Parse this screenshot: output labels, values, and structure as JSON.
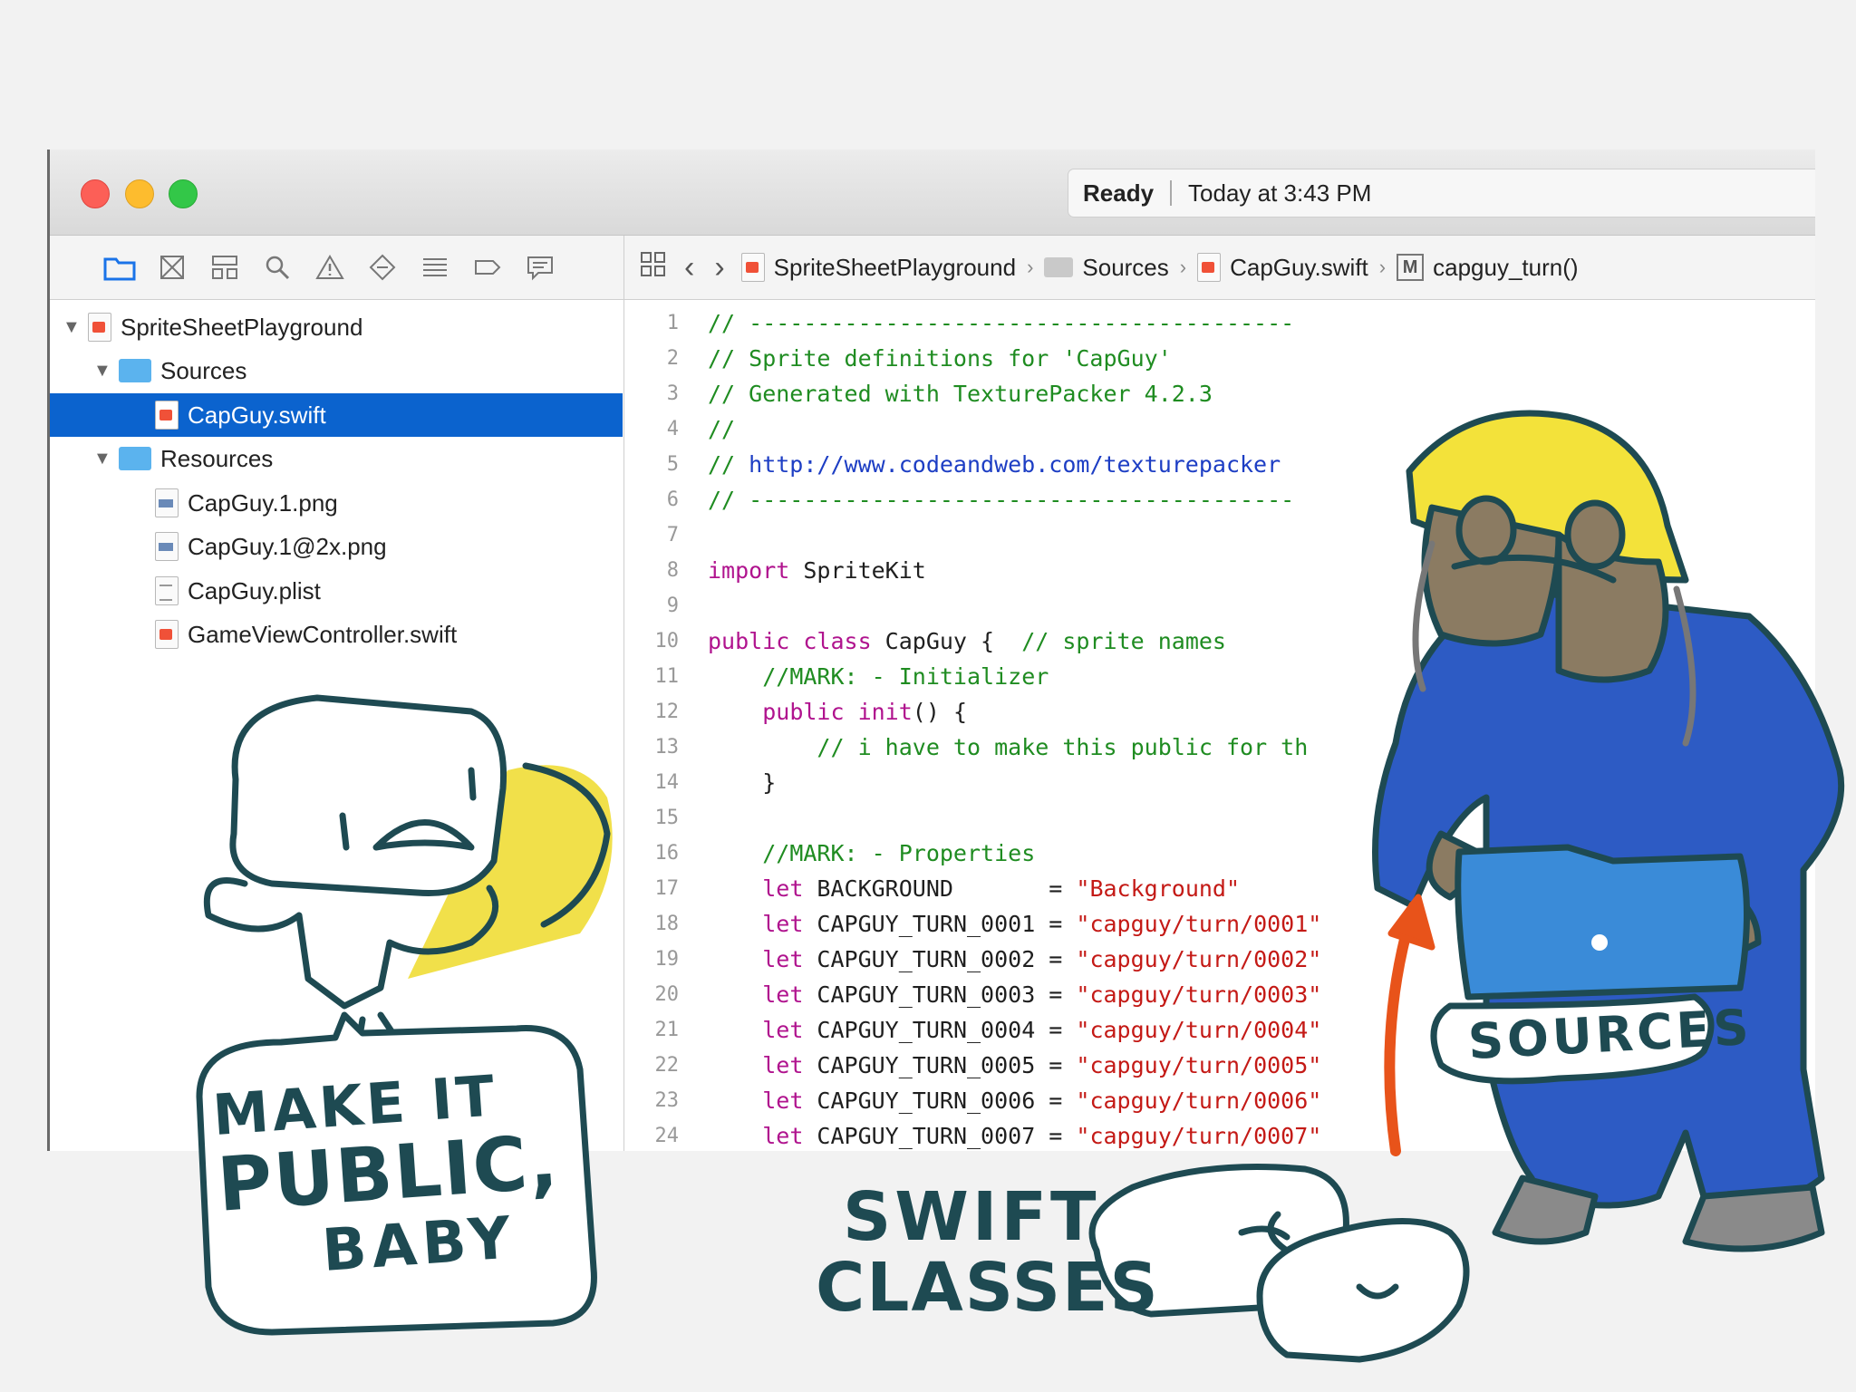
{
  "window": {
    "status": {
      "state": "Ready",
      "time": "Today at 3:43 PM"
    }
  },
  "jumpbar": {
    "items": [
      "SpriteSheetPlayground",
      "Sources",
      "CapGuy.swift",
      "capguy_turn()"
    ]
  },
  "navigator": {
    "project": "SpriteSheetPlayground",
    "groups": [
      {
        "name": "Sources",
        "files": [
          "CapGuy.swift"
        ]
      },
      {
        "name": "Resources",
        "files": [
          "CapGuy.1.png",
          "CapGuy.1@2x.png",
          "CapGuy.plist",
          "GameViewController.swift"
        ]
      }
    ],
    "selected": "CapGuy.swift"
  },
  "editor": {
    "lines": [
      {
        "n": "1",
        "cm": "// ----------------------------------------"
      },
      {
        "n": "2",
        "cm": "// Sprite definitions for 'CapGuy'"
      },
      {
        "n": "3",
        "cm": "// Generated with TexturePacker 4.2.3"
      },
      {
        "n": "4",
        "cm": "//"
      },
      {
        "n": "5",
        "cm": "// ",
        "url": "http://www.codeandweb.com/texturepacker"
      },
      {
        "n": "6",
        "cm": "// ----------------------------------------"
      },
      {
        "n": "7"
      },
      {
        "n": "8",
        "kw": "import",
        "pl": " SpriteKit"
      },
      {
        "n": "9"
      },
      {
        "n": "10",
        "kw": "public class",
        "pl": " CapGuy {  ",
        "cm2": "// sprite names"
      },
      {
        "n": "11",
        "indent": "    ",
        "cm": "//MARK: - Initializer"
      },
      {
        "n": "12",
        "indent": "    ",
        "kw": "public init",
        "pl": "() {"
      },
      {
        "n": "13",
        "indent": "        ",
        "cm": "// i have to make this public for th"
      },
      {
        "n": "14",
        "indent": "    ",
        "pl": "}"
      },
      {
        "n": "15"
      },
      {
        "n": "16",
        "indent": "    ",
        "cm": "//MARK: - Properties"
      },
      {
        "n": "17",
        "indent": "    ",
        "kw": "let",
        "pl": " BACKGROUND       = ",
        "st": "\"Background\""
      },
      {
        "n": "18",
        "indent": "    ",
        "kw": "let",
        "pl": " CAPGUY_TURN_0001 = ",
        "st": "\"capguy/turn/0001\""
      },
      {
        "n": "19",
        "indent": "    ",
        "kw": "let",
        "pl": " CAPGUY_TURN_0002 = ",
        "st": "\"capguy/turn/0002\""
      },
      {
        "n": "20",
        "indent": "    ",
        "kw": "let",
        "pl": " CAPGUY_TURN_0003 = ",
        "st": "\"capguy/turn/0003\""
      },
      {
        "n": "21",
        "indent": "    ",
        "kw": "let",
        "pl": " CAPGUY_TURN_0004 = ",
        "st": "\"capguy/turn/0004\""
      },
      {
        "n": "22",
        "indent": "    ",
        "kw": "let",
        "pl": " CAPGUY_TURN_0005 = ",
        "st": "\"capguy/turn/0005\""
      },
      {
        "n": "23",
        "indent": "    ",
        "kw": "let",
        "pl": " CAPGUY_TURN_0006 = ",
        "st": "\"capguy/turn/0006\""
      },
      {
        "n": "24",
        "indent": "    ",
        "kw": "let",
        "pl": " CAPGUY_TURN_0007 = ",
        "st": "\"capguy/turn/0007\""
      }
    ]
  },
  "doodles": {
    "left_bubble": [
      "MAKE IT",
      "PUBLIC,",
      "BABY"
    ],
    "bottom_caption": [
      "SWIFT",
      "CLASSES"
    ],
    "right_label": "SOURCES"
  },
  "colors": {
    "selection": "#0b63ce",
    "comment": "#1f8c21",
    "keyword": "#b0138e",
    "string": "#c41a16",
    "ink": "#1e4a52",
    "helmet": "#f3e23a",
    "overalls": "#2d5bc4",
    "arrow": "#e8531a"
  }
}
